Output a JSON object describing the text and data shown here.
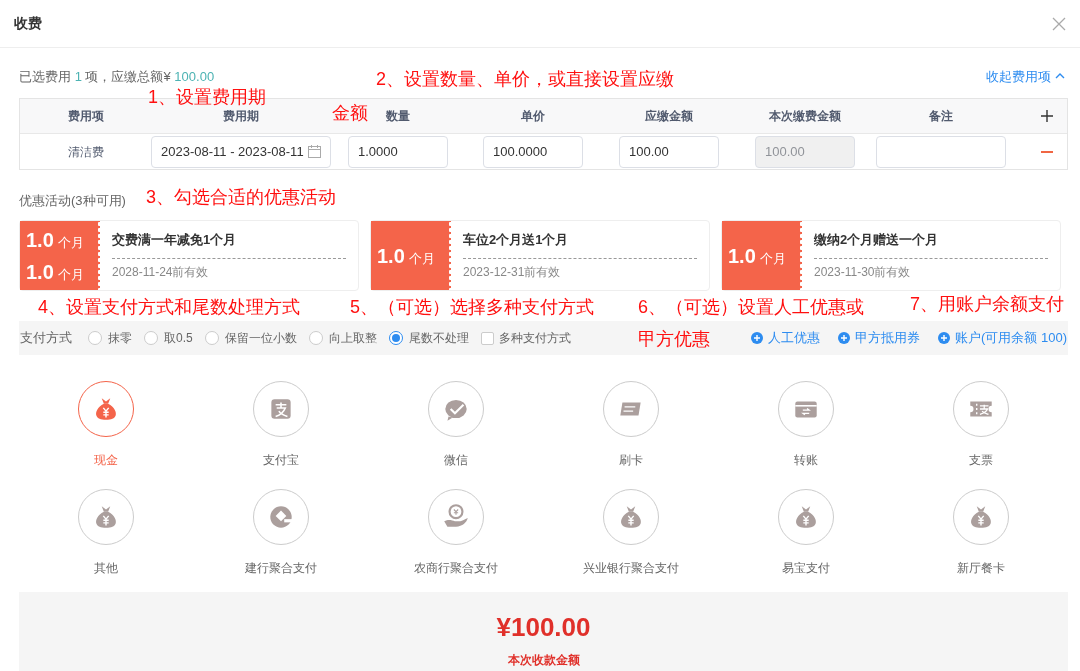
{
  "dialog": {
    "title": "收费"
  },
  "summary": {
    "prefix": "已选费用",
    "count": "1",
    "middle": "项，应缴总额¥",
    "total": "100.00"
  },
  "collapse_link": "收起费用项",
  "table": {
    "columns": [
      "费用项",
      "费用期",
      "数量",
      "单价",
      "应缴金额",
      "本次缴费金额",
      "备注"
    ],
    "rows": [
      {
        "item": "清洁费",
        "period": "2023-08-11 - 2023-08-11",
        "quantity": "1.0000",
        "unit_price": "100.0000",
        "amount_due": "100.00",
        "amount_paid": "100.00"
      }
    ]
  },
  "discounts": {
    "label": "优惠活动(3种可用)",
    "coupons": [
      {
        "values": [
          {
            "amount": "1.0",
            "unit": "个月"
          },
          {
            "amount": "1.0",
            "unit": "个月"
          }
        ],
        "title": "交费满一年减免1个月",
        "expiry": "2028-11-24前有效"
      },
      {
        "values": [
          {
            "amount": "1.0",
            "unit": "个月"
          }
        ],
        "title": "车位2个月送1个月",
        "expiry": "2023-12-31前有效"
      },
      {
        "values": [
          {
            "amount": "1.0",
            "unit": "个月"
          }
        ],
        "title": "缴纳2个月赠送一个月",
        "expiry": "2023-11-30前有效"
      }
    ]
  },
  "payment": {
    "label": "支付方式",
    "rounding": [
      {
        "label": "抹零",
        "selected": false
      },
      {
        "label": "取0.5",
        "selected": false
      },
      {
        "label": "保留一位小数",
        "selected": false
      },
      {
        "label": "向上取整",
        "selected": false
      },
      {
        "label": "尾数不处理",
        "selected": true
      }
    ],
    "multiple": {
      "label": "多种支付方式",
      "checked": false
    },
    "links": [
      "人工优惠",
      "甲方抵用券",
      "账户(可用余额 100)"
    ]
  },
  "methods": [
    {
      "label": "现金",
      "selected": true
    },
    {
      "label": "支付宝",
      "selected": false
    },
    {
      "label": "微信",
      "selected": false
    },
    {
      "label": "刷卡",
      "selected": false
    },
    {
      "label": "转账",
      "selected": false
    },
    {
      "label": "支票",
      "selected": false
    },
    {
      "label": "其他",
      "selected": false
    },
    {
      "label": "建行聚合支付",
      "selected": false
    },
    {
      "label": "农商行聚合支付",
      "selected": false
    },
    {
      "label": "兴业银行聚合支付",
      "selected": false
    },
    {
      "label": "易宝支付",
      "selected": false
    },
    {
      "label": "新厅餐卡",
      "selected": false
    }
  ],
  "total": {
    "amount": "¥100.00",
    "label": "本次收款金额"
  },
  "annotations": [
    {
      "lines": [
        "1、设置费用期"
      ]
    },
    {
      "lines": [
        "2、设置数量、单价，或直接设置应缴",
        "金额"
      ]
    },
    {
      "lines": [
        "3、勾选合适的优惠活动"
      ]
    },
    {
      "lines": [
        "4、设置支付方式和尾数处理方式"
      ]
    },
    {
      "lines": [
        "5、（可选）选择多种支付方式"
      ]
    },
    {
      "lines": [
        "6、（可选）设置人工优惠或",
        "甲方优惠"
      ]
    },
    {
      "lines": [
        "7、用账户余额支付"
      ]
    }
  ]
}
